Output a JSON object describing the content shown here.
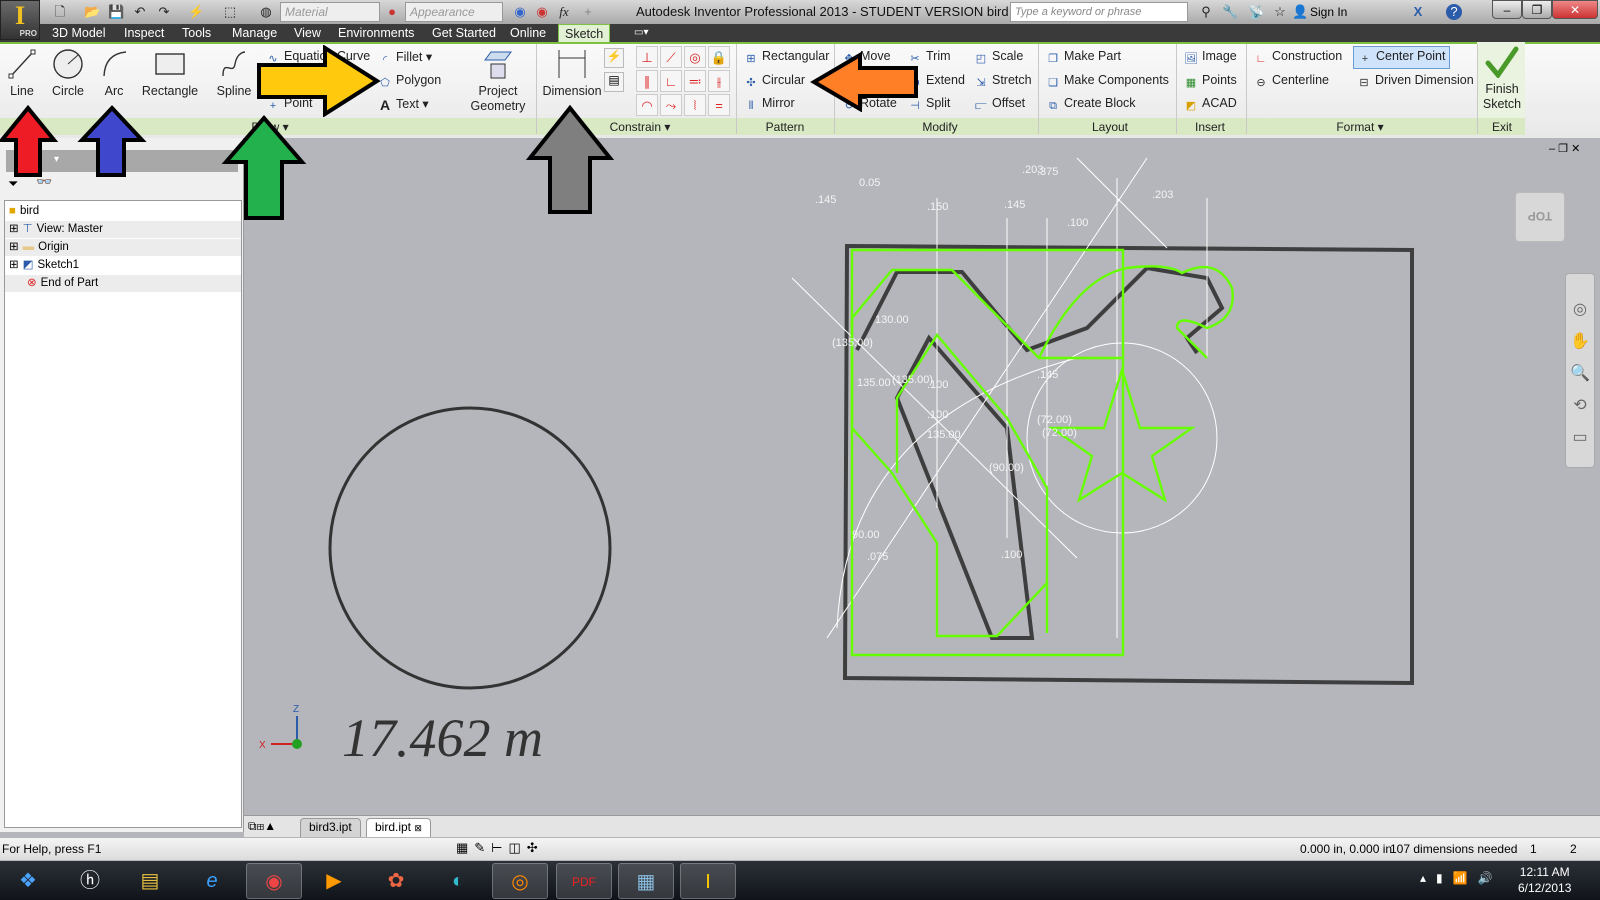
{
  "app": {
    "logo_text": "I",
    "edition": "PRO",
    "title": "Autodesk Inventor Professional 2013 - STUDENT VERSION    bird",
    "material_placeholder": "Material",
    "appearance_placeholder": "Appearance",
    "search_placeholder": "Type a keyword or phrase",
    "sign_in": "Sign In",
    "fx": "fx"
  },
  "menu": [
    "3D Model",
    "Inspect",
    "Tools",
    "Manage",
    "View",
    "Environments",
    "Get Started",
    "Online",
    "Sketch"
  ],
  "active_tab": "Sketch",
  "ribbon": {
    "draw": {
      "line": "Line",
      "circle": "Circle",
      "arc": "Arc",
      "rectangle": "Rectangle",
      "spline": "Spline",
      "equation_curve": "Equation Curve",
      "point": "Point",
      "fillet": "Fillet",
      "polygon": "Polygon",
      "text": "Text",
      "project_geometry": "Project Geometry",
      "label": "Draw"
    },
    "constrain": {
      "dimension": "Dimension",
      "label": "Constrain"
    },
    "pattern": {
      "rectangular": "Rectangular",
      "circular": "Circular",
      "mirror": "Mirror",
      "label": "Pattern"
    },
    "modify": {
      "move": "Move",
      "trim": "Trim",
      "scale": "Scale",
      "extend": "Extend",
      "stretch": "Stretch",
      "rotate": "Rotate",
      "split": "Split",
      "offset": "Offset",
      "label": "Modify"
    },
    "layout": {
      "make_part": "Make Part",
      "make_components": "Make Components",
      "create_block": "Create Block",
      "label": "Layout"
    },
    "insert": {
      "image": "Image",
      "points": "Points",
      "acad": "ACAD",
      "label": "Insert"
    },
    "format": {
      "construction": "Construction",
      "center_point": "Center Point",
      "centerline": "Centerline",
      "driven_dimension": "Driven Dimension",
      "label": "Format"
    },
    "exit": {
      "finish_sketch": "Finish Sketch",
      "label": "Exit"
    }
  },
  "browser": {
    "tree": [
      "bird",
      "View: Master",
      "Origin",
      "Sketch1",
      "End of Part"
    ]
  },
  "viewcube": {
    "label": "TOP"
  },
  "canvas": {
    "handwritten_note": "17.462 m",
    "dimensions": [
      ".145",
      "0.05",
      ".150",
      ".203",
      ".145",
      ".100",
      ".375",
      ".203",
      "130.00",
      "(135.00)",
      "135.00",
      "(135.00)",
      ".100",
      "(72.00)",
      "(72.00)",
      ".145",
      "135.00",
      ".100",
      "90.00",
      ".075",
      "(90.00)",
      ".100"
    ]
  },
  "doc_tabs": [
    "bird3.ipt",
    "bird.ipt"
  ],
  "status": {
    "help": "For Help, press F1",
    "coords": "0.000 in, 0.000 in",
    "dims_needed": "107 dimensions needed",
    "count1": "1",
    "count2": "2"
  },
  "taskbar": {
    "time": "12:11 AM",
    "date": "6/12/2013"
  },
  "annotation_arrows": {
    "red": "#ee1c24",
    "blue": "#3f48cc",
    "green": "#22b14c",
    "gray": "#7f7f7f",
    "yellow": "#ffc90e",
    "orange": "#ff7f27"
  },
  "colors": {
    "sketch_green": "#66ff00",
    "ribbon_accent": "#7dc142"
  }
}
